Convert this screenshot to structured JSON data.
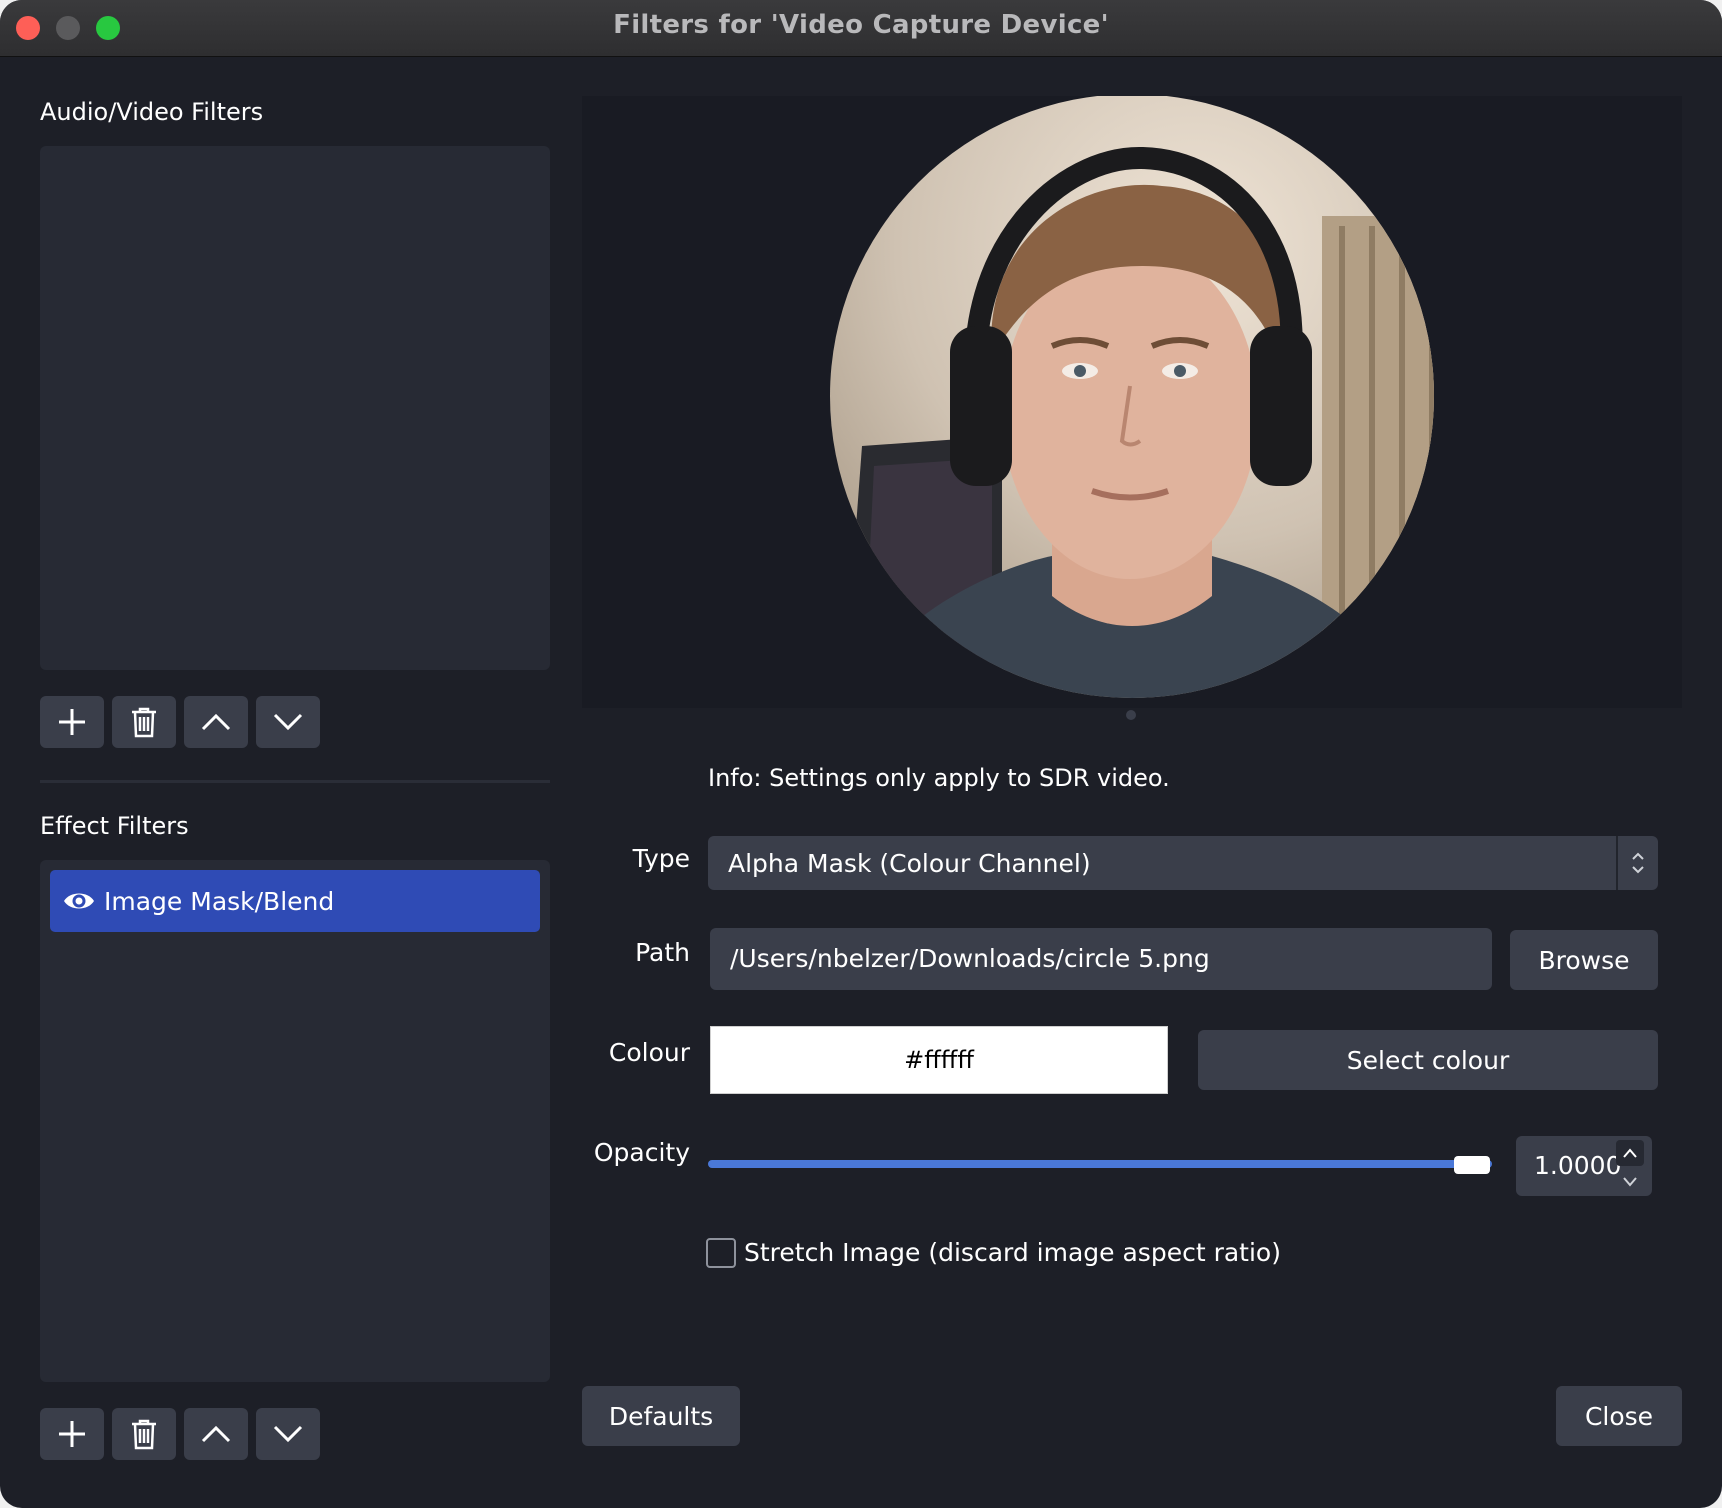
{
  "window": {
    "title": "Filters for 'Video Capture Device'"
  },
  "av_filters": {
    "heading": "Audio/Video Filters",
    "items": []
  },
  "effect_filters": {
    "heading": "Effect Filters",
    "items": [
      {
        "label": "Image Mask/Blend",
        "visible": true,
        "selected": true
      }
    ]
  },
  "toolbar_icons": [
    "plus-icon",
    "trash-icon",
    "chevron-up-icon",
    "chevron-down-icon"
  ],
  "settings": {
    "info": "Info: Settings only apply to SDR video.",
    "type_label": "Type",
    "type_value": "Alpha Mask (Colour Channel)",
    "path_label": "Path",
    "path_value": "/Users/nbelzer/Downloads/circle 5.png",
    "browse_label": "Browse",
    "colour_label": "Colour",
    "colour_value": "#ffffff",
    "select_colour_label": "Select colour",
    "opacity_label": "Opacity",
    "opacity_value": "1.0000",
    "opacity_fraction": 1.0,
    "stretch_label": "Stretch Image (discard image aspect ratio)",
    "stretch_checked": false
  },
  "footer": {
    "defaults_label": "Defaults",
    "close_label": "Close"
  },
  "colors": {
    "window_bg": "#1d1f27",
    "panel_bg": "#272a34",
    "button_bg": "#3a3e4a",
    "selection": "#2f4bb5",
    "slider": "#4a78d8"
  }
}
